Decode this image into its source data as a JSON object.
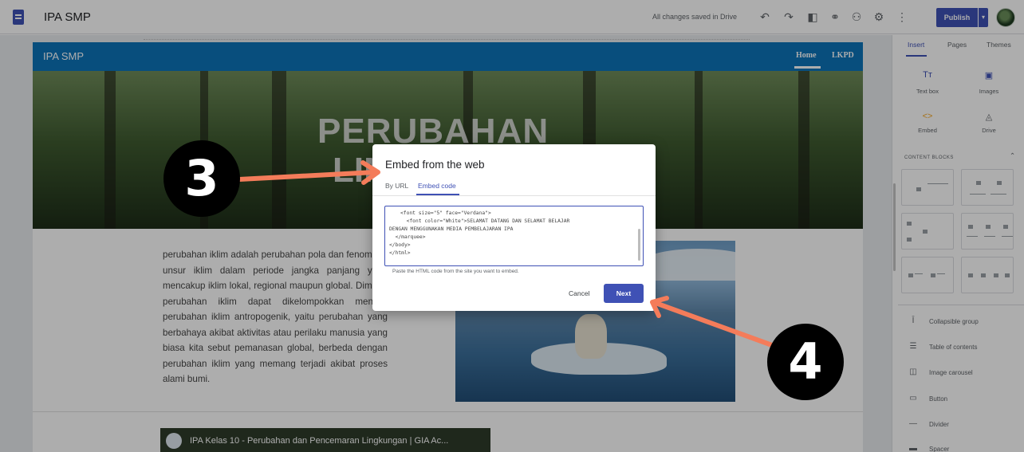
{
  "app": {
    "title": "IPA SMP",
    "save_status": "All changes saved in Drive",
    "publish_label": "Publish"
  },
  "toolbar_icons": [
    "undo-icon",
    "redo-icon",
    "preview-icon",
    "link-icon",
    "share-icon",
    "settings-icon",
    "more-icon"
  ],
  "site": {
    "name": "IPA SMP",
    "nav": [
      "Home",
      "LKPD"
    ],
    "hero_title_line1": "PERUBAHAN",
    "hero_title_line2": "LIN",
    "body_text": "perubahan iklim adalah perubahan pola dan fenomena unsur iklim dalam periode jangka panjang yang mencakup iklim lokal, regional maupun global. Dimana perubahan iklim dapat dikelompokkan menjadi perubahan iklim antropogenik, yaitu perubahan yang berbahaya akibat aktivitas atau perilaku manusia yang biasa kita sebut pemanasan global, berbeda dengan perubahan iklim yang memang terjadi akibat proses alami bumi.",
    "video_title": "IPA Kelas 10 - Perubahan dan Pencemaran Lingkungan | GIA Ac..."
  },
  "panel": {
    "tabs": [
      "Insert",
      "Pages",
      "Themes"
    ],
    "insert_items": [
      {
        "label": "Text box",
        "icon": "Tт"
      },
      {
        "label": "Images",
        "icon": "▣"
      },
      {
        "label": "Embed",
        "icon": "<>"
      },
      {
        "label": "Drive",
        "icon": "◬"
      }
    ],
    "content_blocks_title": "CONTENT BLOCKS",
    "list_items": [
      {
        "label": "Collapsible group",
        "icon": "Ī"
      },
      {
        "label": "Table of contents",
        "icon": "☰"
      },
      {
        "label": "Image carousel",
        "icon": "◫"
      },
      {
        "label": "Button",
        "icon": "▭"
      },
      {
        "label": "Divider",
        "icon": "—"
      },
      {
        "label": "Spacer",
        "icon": "▬"
      }
    ]
  },
  "dialog": {
    "title": "Embed from the web",
    "tabs": [
      "By URL",
      "Embed code"
    ],
    "code_lines": [
      "<font size=\"5\" face=\"Verdana\">",
      "  <font color=\"White\">SELAMAT DATANG DAN SELAMAT BELAJAR",
      "DENGAN MENGGUNAKAN MEDIA PEMBELAJARAN IPA",
      "  </marquee>",
      "</body>",
      "",
      "</html>"
    ],
    "hint": "Paste the HTML code from the site you want to embed.",
    "cancel_label": "Cancel",
    "next_label": "Next"
  },
  "steps": [
    "3",
    "4"
  ],
  "colors": {
    "accent": "#3f51b5",
    "site_nav": "#0d73b9",
    "arrow": "#f47c5a"
  }
}
